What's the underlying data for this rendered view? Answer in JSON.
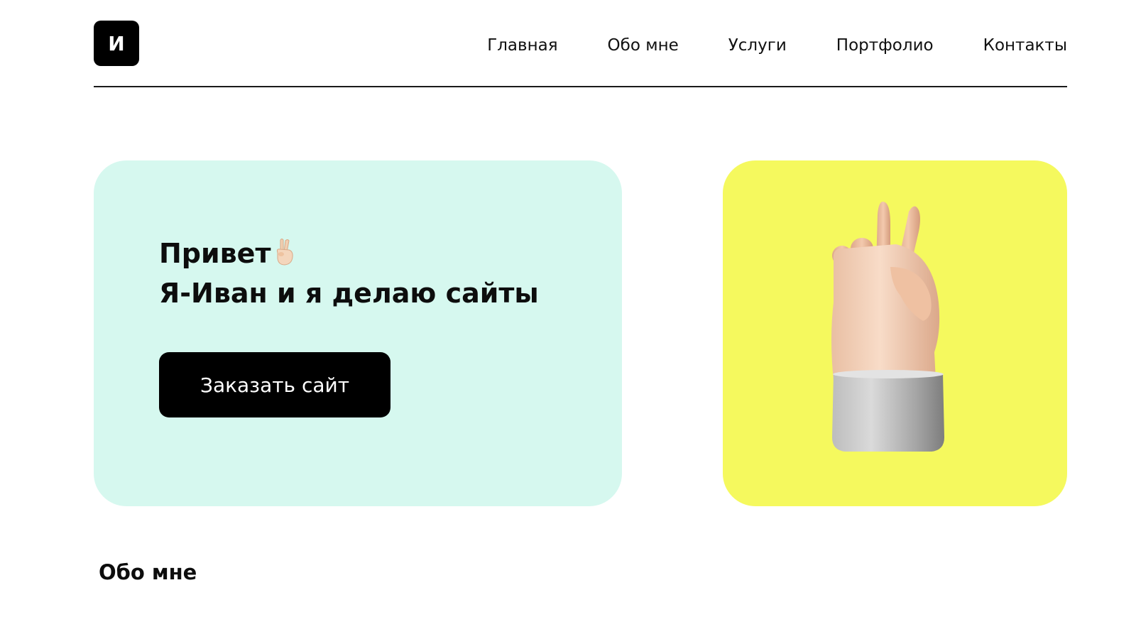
{
  "header": {
    "logo_letter": "И",
    "nav": [
      {
        "label": "Главная"
      },
      {
        "label": "Обо мне"
      },
      {
        "label": "Услуги"
      },
      {
        "label": "Портфолио"
      },
      {
        "label": "Контакты"
      }
    ]
  },
  "hero": {
    "greeting": "Привет",
    "greeting_icon": "victory-hand-icon",
    "subtitle": "Я-Иван и я делаю сайты",
    "button_label": "Заказать сайт",
    "card_color": "#d6f8ef",
    "image_card_color": "#f5f95e",
    "image": "victory-hand-illustration"
  },
  "about": {
    "title": "Обо мне"
  }
}
